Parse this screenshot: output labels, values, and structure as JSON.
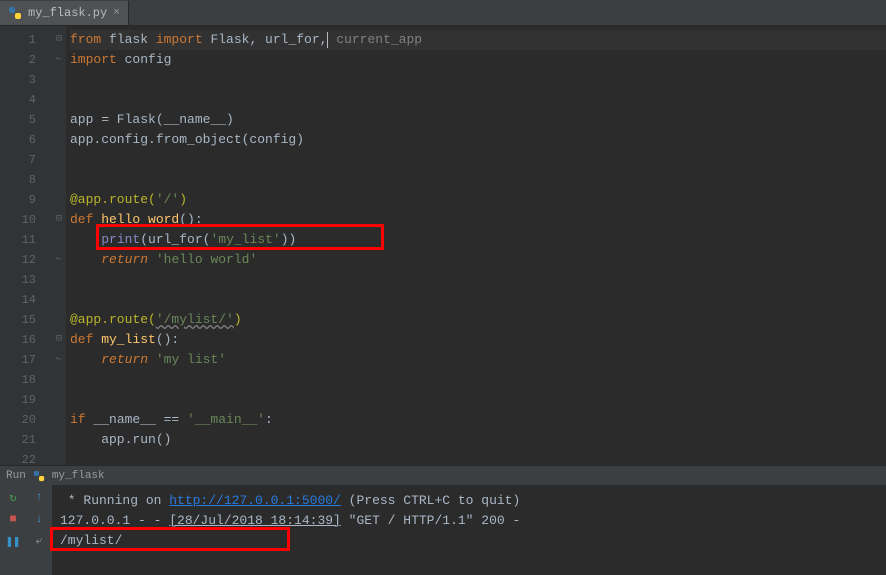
{
  "tab": {
    "filename": "my_flask.py"
  },
  "gutter": {
    "lines": [
      "1",
      "2",
      "3",
      "4",
      "5",
      "6",
      "7",
      "8",
      "9",
      "10",
      "11",
      "12",
      "13",
      "14",
      "15",
      "16",
      "17",
      "18",
      "19",
      "20",
      "21",
      "22"
    ]
  },
  "code": {
    "l1": {
      "kw_from": "from",
      "mod": " flask ",
      "kw_import": "import",
      "names": " Flask, url_for,",
      "hint": " current_app"
    },
    "l2": {
      "kw": "import",
      "mod": " config"
    },
    "l5": {
      "a": "app = Flask(",
      "b": "__name__",
      "c": ")"
    },
    "l6": "app.config.from_object(config)",
    "l9": {
      "at": "@app.route",
      "p": "(",
      "s": "'/'",
      "q": ")"
    },
    "l10": {
      "kw": "def",
      "name": " hello_word",
      "rest": "():"
    },
    "l11": {
      "indent": "    ",
      "pr": "print",
      "p1": "(",
      "fn": "url_for",
      "p2": "(",
      "s": "'my_list'",
      "p3": "))"
    },
    "l12": {
      "indent": "    ",
      "kw": "return",
      "sp": " ",
      "s": "'hello world'"
    },
    "l15": {
      "at": "@app.route",
      "p": "(",
      "s": "'/mylist/'",
      "q": ")"
    },
    "l16": {
      "kw": "def",
      "name": " my_list",
      "rest": "():"
    },
    "l17": {
      "indent": "    ",
      "kw": "return",
      "sp": " ",
      "s": "'my list'"
    },
    "l20": {
      "kw": "if",
      "name": " __name__ ",
      "op": "== ",
      "s": "'__main__'",
      "colon": ":"
    },
    "l21": "    app.run()"
  },
  "run": {
    "label": "Run",
    "config_name": "my_flask",
    "line1_a": " * Running on ",
    "line1_url": "http://127.0.0.1:5000/",
    "line1_b": " (Press CTRL+C to quit)",
    "line2_a": "127.0.0.1 - - ",
    "line2_ts": "[28/Jul/2018 18:14:39]",
    "line2_b": " \"GET / HTTP/1.1\" 200 -",
    "line3": "/mylist/"
  }
}
